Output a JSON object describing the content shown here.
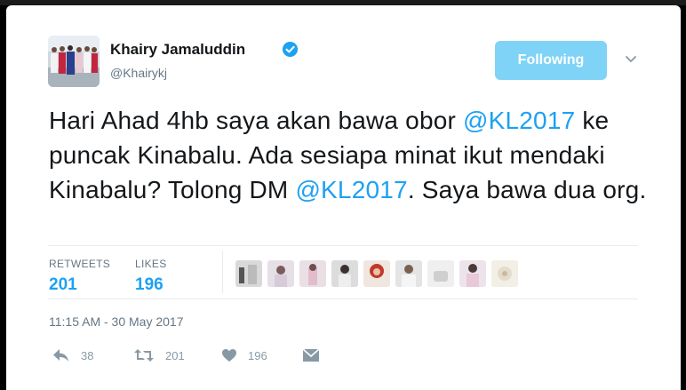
{
  "user": {
    "name": "Khairy Jamaluddin",
    "handle": "@Khairykj",
    "verified": true
  },
  "follow_button": {
    "label": "Following"
  },
  "tweet": {
    "segments": [
      {
        "text": "Hari Ahad 4hb saya akan bawa obor ",
        "type": "text"
      },
      {
        "text": "@KL2017",
        "type": "mention"
      },
      {
        "text": " ke puncak Kinabalu. Ada sesiapa minat ikut mendaki Kinabalu? Tolong DM ",
        "type": "text"
      },
      {
        "text": "@KL2017",
        "type": "mention"
      },
      {
        "text": ". Saya bawa dua org.",
        "type": "text"
      }
    ]
  },
  "stats": {
    "retweets_label": "RETWEETS",
    "retweets_value": "201",
    "likes_label": "LIKES",
    "likes_value": "196"
  },
  "timestamp": "11:15 AM - 30 May 2017",
  "actions": {
    "reply_count": "38",
    "retweet_count": "201",
    "like_count": "196"
  },
  "icons": {
    "verified": "verified-badge-icon",
    "chevron": "chevron-down-icon",
    "reply": "reply-icon",
    "retweet": "retweet-icon",
    "like": "heart-icon",
    "dm": "envelope-icon"
  },
  "colors": {
    "accent": "#1da1f2",
    "follow_button": "#7fd3f7",
    "muted": "#657786"
  }
}
